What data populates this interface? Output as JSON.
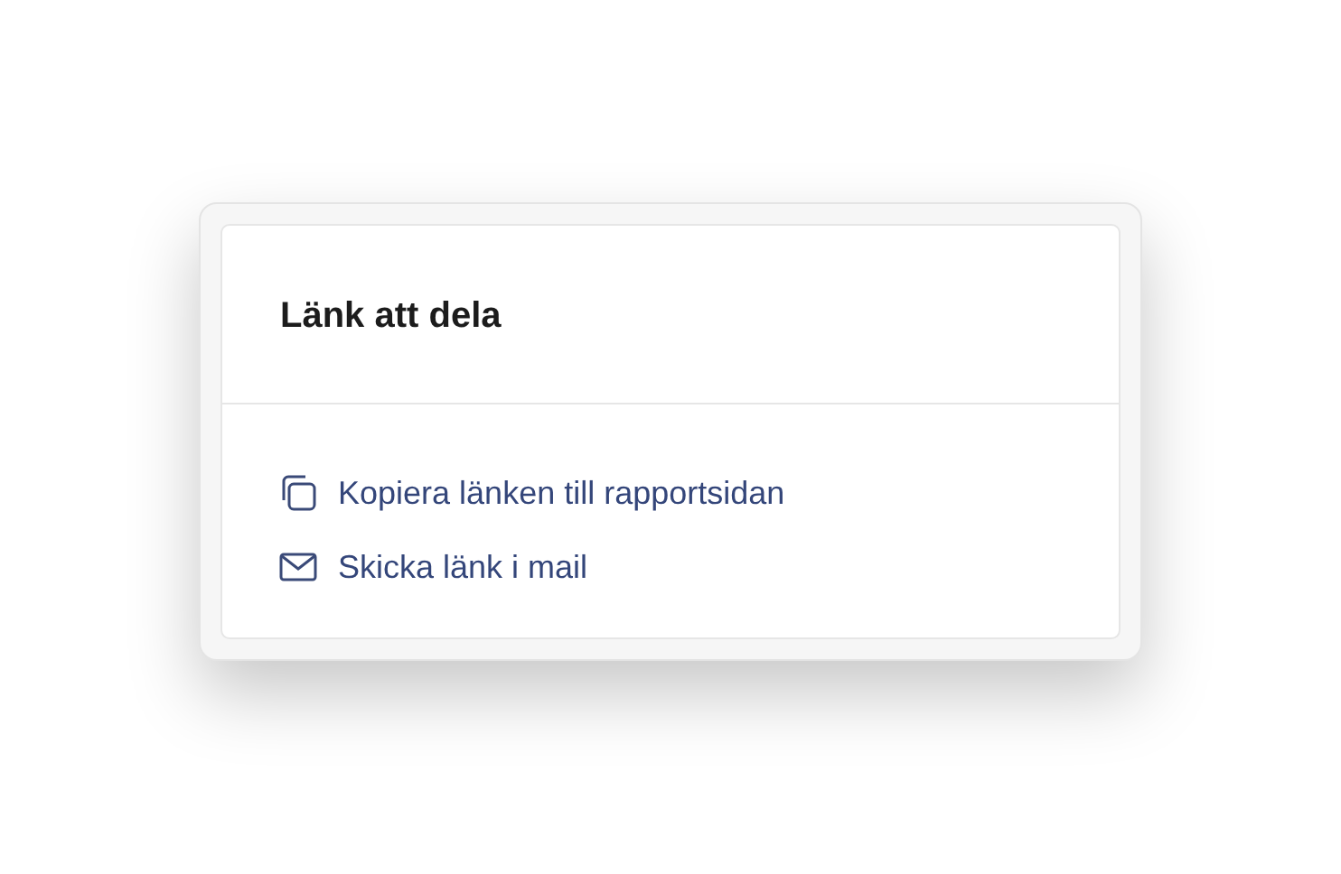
{
  "dialog": {
    "title": "Länk att dela",
    "actions": [
      {
        "kind": "copy",
        "label": "Kopiera länken till rapportsidan"
      },
      {
        "kind": "mail",
        "label": "Skicka länk i mail"
      }
    ]
  }
}
